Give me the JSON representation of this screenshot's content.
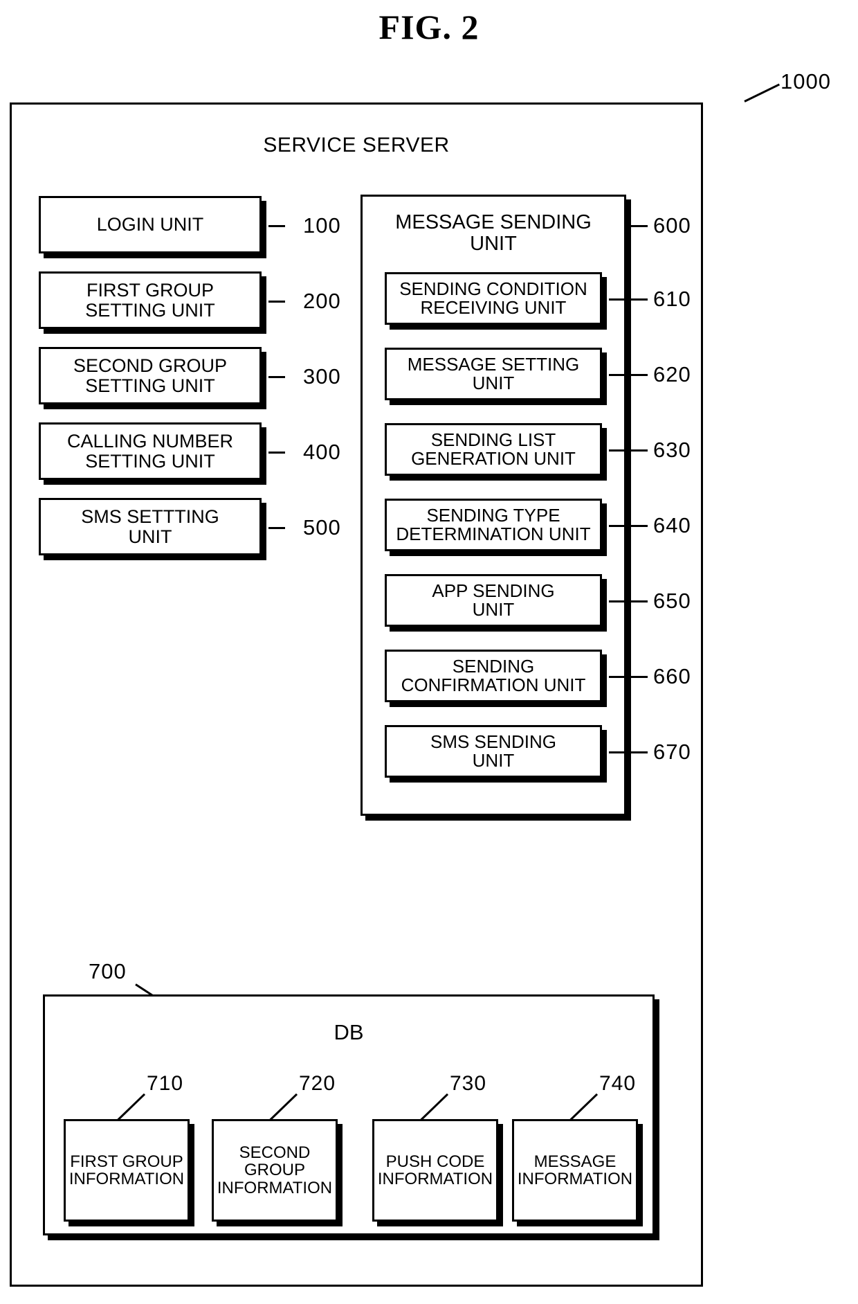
{
  "figure": {
    "title": "FIG. 2",
    "outer_ref": "1000",
    "server_title": "SERVICE SERVER"
  },
  "left_units": [
    {
      "label": "LOGIN UNIT",
      "ref": "100"
    },
    {
      "label": "FIRST GROUP\nSETTING UNIT",
      "ref": "200"
    },
    {
      "label": "SECOND GROUP\nSETTING UNIT",
      "ref": "300"
    },
    {
      "label": "CALLING NUMBER\nSETTING UNIT",
      "ref": "400"
    },
    {
      "label": "SMS SETTTING\nUNIT",
      "ref": "500"
    }
  ],
  "message_sending_unit": {
    "label": "MESSAGE SENDING\nUNIT",
    "ref": "600",
    "sub_units": [
      {
        "label": "SENDING CONDITION\nRECEIVING UNIT",
        "ref": "610"
      },
      {
        "label": "MESSAGE SETTING\nUNIT",
        "ref": "620"
      },
      {
        "label": "SENDING LIST\nGENERATION UNIT",
        "ref": "630"
      },
      {
        "label": "SENDING TYPE\nDETERMINATION UNIT",
        "ref": "640"
      },
      {
        "label": "APP SENDING\nUNIT",
        "ref": "650"
      },
      {
        "label": "SENDING\nCONFIRMATION UNIT",
        "ref": "660"
      },
      {
        "label": "SMS SENDING\nUNIT",
        "ref": "670"
      }
    ]
  },
  "db": {
    "label": "DB",
    "ref": "700",
    "items": [
      {
        "label": "FIRST GROUP\nINFORMATION",
        "ref": "710"
      },
      {
        "label": "SECOND\nGROUP\nINFORMATION",
        "ref": "720"
      },
      {
        "label": "PUSH CODE\nINFORMATION",
        "ref": "730"
      },
      {
        "label": "MESSAGE\nINFORMATION",
        "ref": "740"
      }
    ]
  }
}
